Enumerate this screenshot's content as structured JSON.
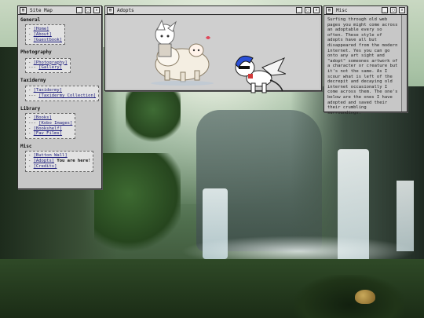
{
  "windows": {
    "sitemap": {
      "title": "Site Map",
      "sections": [
        {
          "title": "General",
          "items": [
            {
              "prefix": "- ",
              "label": "[Home]"
            },
            {
              "prefix": "- ",
              "label": "[About]"
            },
            {
              "prefix": "- ",
              "label": "[Guestbook]"
            }
          ]
        },
        {
          "title": "Photography",
          "items": [
            {
              "prefix": "- ",
              "label": "[Photography]"
            },
            {
              "prefix": "--- ",
              "label": "[Gallery]"
            }
          ]
        },
        {
          "title": "Taxidermy",
          "items": [
            {
              "prefix": "- ",
              "label": "[Taxidermy]"
            },
            {
              "prefix": "--- ",
              "label": "[Taxidermy Collection]"
            }
          ]
        },
        {
          "title": "Library",
          "items": [
            {
              "prefix": "- ",
              "label": "[Books]"
            },
            {
              "prefix": "--- ",
              "label": "[Kobo Images]"
            },
            {
              "prefix": "- ",
              "label": "[Bookshelf]"
            },
            {
              "prefix": "- ",
              "label": "[Fav Films]"
            }
          ]
        },
        {
          "title": "Misc",
          "items": [
            {
              "prefix": "- ",
              "label": "[Button Wall]"
            },
            {
              "prefix": "- ",
              "label": "[Adopts]",
              "suffix": " You are here!"
            },
            {
              "prefix": "- ",
              "label": "[Credits]"
            }
          ]
        }
      ]
    },
    "adopts": {
      "title": "Adopts"
    },
    "misc": {
      "title": "Misc",
      "text": "Surfing through old web pages you might come across an adoptable every so often. These style of adopts have all but disappeared from the modern internet. Yes you can go onto any art sight and \"adopt\" someones artwork of a character or creature but it's not the same. As I scour what is left of the decrepit and decaying old internet occasionally I come across them. The one's below are the ones I have adopted and saved their their crumbling surroundings."
    }
  },
  "title_buttons": {
    "minimize": "_",
    "maximize": "□",
    "close": "✕"
  },
  "icons": {
    "window_icon": "window-icon"
  }
}
